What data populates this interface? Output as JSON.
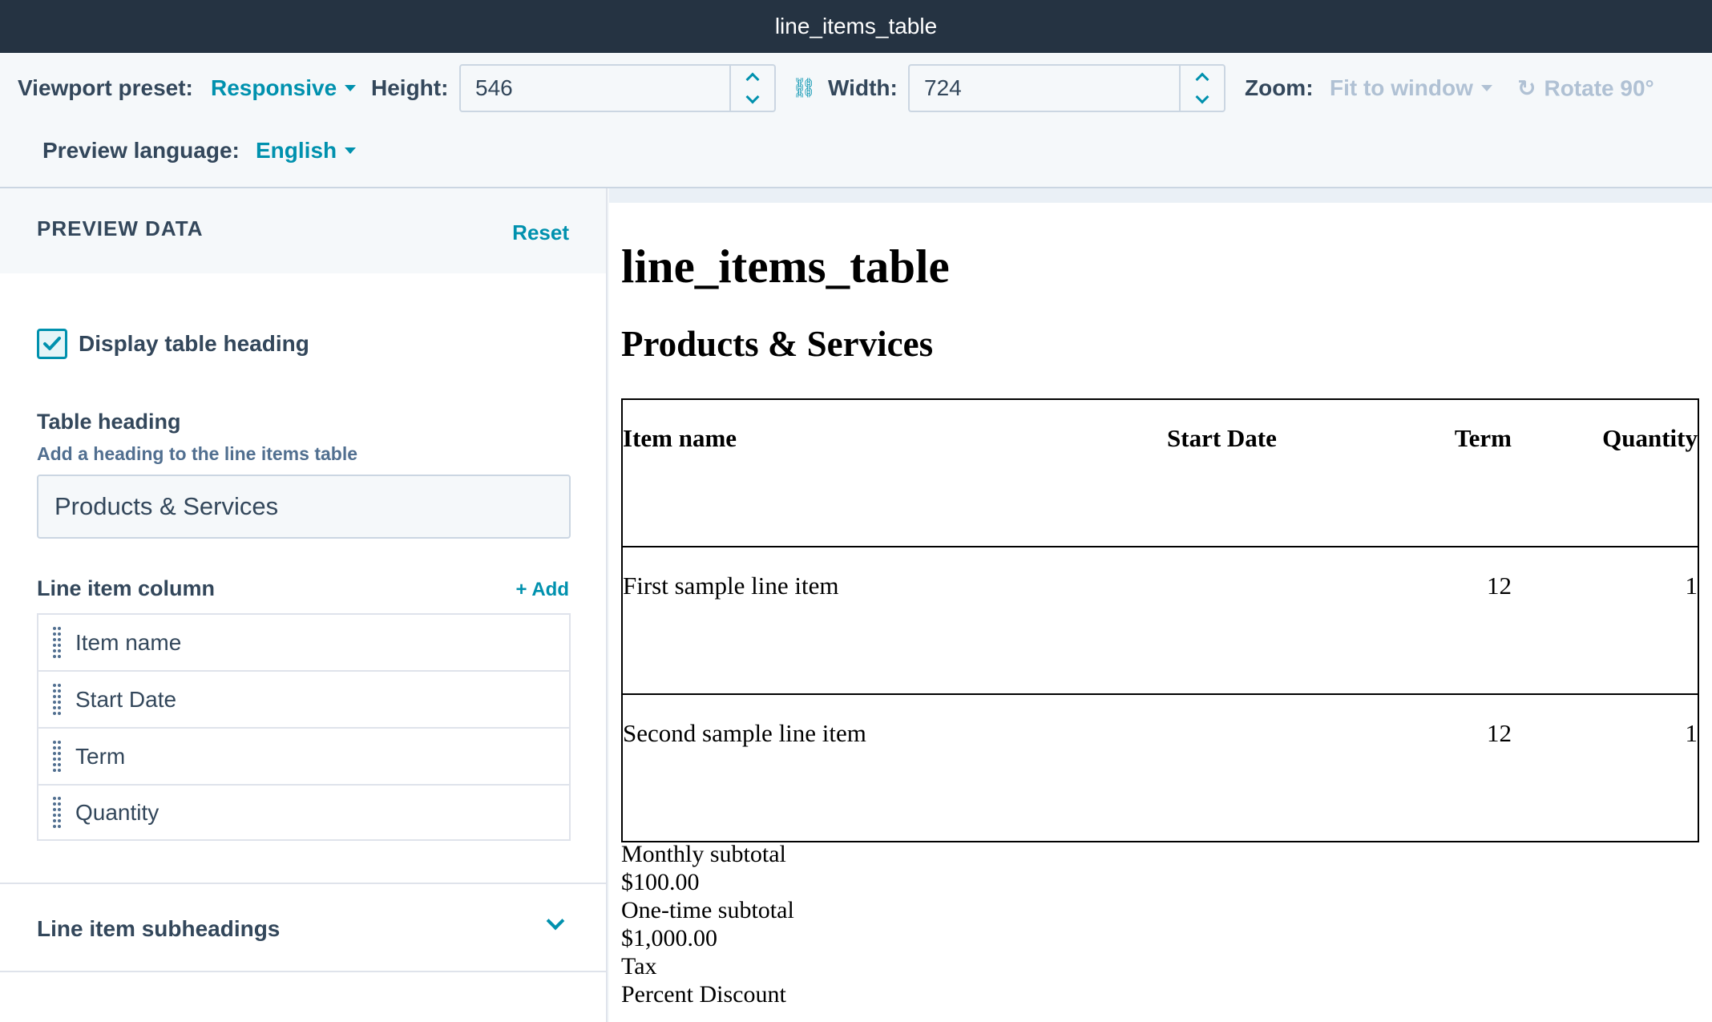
{
  "window": {
    "title": "line_items_table"
  },
  "toolbar": {
    "viewport_label": "Viewport preset:",
    "viewport_value": "Responsive",
    "height_label": "Height:",
    "height_value": "546",
    "width_label": "Width:",
    "width_value": "724",
    "zoom_label": "Zoom:",
    "zoom_value": "Fit to window",
    "rotate_label": "Rotate 90°",
    "language_label": "Preview language:",
    "language_value": "English"
  },
  "panel": {
    "title": "PREVIEW DATA",
    "reset": "Reset",
    "display_heading_label": "Display table heading",
    "display_heading_checked": true,
    "table_heading_label": "Table heading",
    "table_heading_help": "Add a heading to the line items table",
    "table_heading_value": "Products & Services",
    "line_item_column_label": "Line item column",
    "add_label": "+ Add",
    "columns": [
      "Item name",
      "Start Date",
      "Term",
      "Quantity"
    ],
    "subheadings_label": "Line item subheadings"
  },
  "preview": {
    "title": "line_items_table",
    "heading": "Products & Services",
    "headers": [
      "Item name",
      "Start Date",
      "Term",
      "Quantity"
    ],
    "rows": [
      {
        "name": "First sample line item",
        "start": "",
        "term": "12",
        "qty": "1"
      },
      {
        "name": "Second sample line item",
        "start": "",
        "term": "12",
        "qty": "1"
      }
    ],
    "summary": [
      "Monthly subtotal",
      "$100.00",
      "One-time subtotal",
      "$1,000.00",
      "Tax",
      "Percent Discount"
    ]
  },
  "colors": {
    "accent": "#0091ae",
    "titlebar": "#253342",
    "text": "#33475b"
  }
}
